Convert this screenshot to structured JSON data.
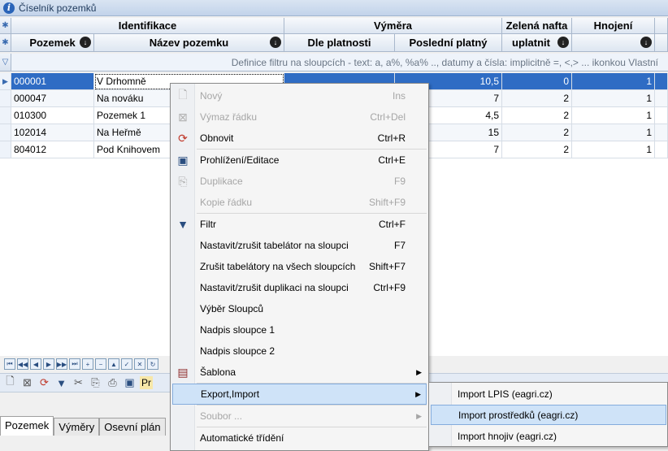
{
  "window": {
    "title": "Číselník pozemků"
  },
  "grid": {
    "group_headers": [
      "Identifikace",
      "Výměra",
      "Zelená nafta",
      "Hnojení"
    ],
    "column_headers": [
      "Pozemek",
      "Název pozemku",
      "Dle platnosti",
      "Poslední platný",
      "uplatnit",
      ""
    ],
    "filter_hint": "Definice filtru na sloupcích - text: a, a%, %a% .., datumy a čísla: implicitně =, <,> ... ikonkou Vlastní",
    "rows": [
      {
        "pozemek": "000001",
        "nazev": "V Drhomně",
        "posledni": "10,5",
        "uplatnit": "0",
        "hnojeni": "1"
      },
      {
        "pozemek": "000047",
        "nazev": "Na nováku",
        "posledni": "7",
        "uplatnit": "2",
        "hnojeni": "1"
      },
      {
        "pozemek": "010300",
        "nazev": "Pozemek 1",
        "posledni": "4,5",
        "uplatnit": "2",
        "hnojeni": "1"
      },
      {
        "pozemek": "102014",
        "nazev": "Na Heřmě",
        "posledni": "15",
        "uplatnit": "2",
        "hnojeni": "1"
      },
      {
        "pozemek": "804012",
        "nazev": "Pod Knihovem",
        "posledni": "7",
        "uplatnit": "2",
        "hnojeni": "1"
      }
    ]
  },
  "toolbar": {
    "truncated_label": "Pr"
  },
  "tabs": [
    "Pozemek",
    "Výměry",
    "Osevní plán"
  ],
  "context_menu": {
    "items": [
      {
        "label": "Nový",
        "shortcut": "Ins",
        "disabled": true,
        "icon": "new-document-icon"
      },
      {
        "label": "Výmaz řádku",
        "shortcut": "Ctrl+Del",
        "disabled": true,
        "icon": "delete-row-icon"
      },
      {
        "label": "Obnovit",
        "shortcut": "Ctrl+R",
        "disabled": false,
        "icon": "refresh-icon"
      },
      {
        "label": "Prohlížení/Editace",
        "shortcut": "Ctrl+E",
        "disabled": false,
        "icon": "edit-view-icon"
      },
      {
        "label": "Duplikace",
        "shortcut": "F9",
        "disabled": true,
        "icon": "duplicate-icon"
      },
      {
        "label": "Kopie řádku",
        "shortcut": "Shift+F9",
        "disabled": true,
        "icon": ""
      },
      {
        "label": "Filtr",
        "shortcut": "Ctrl+F",
        "disabled": false,
        "icon": "filter-icon"
      },
      {
        "label": "Nastavit/zrušit tabelátor na sloupci",
        "shortcut": "F7",
        "disabled": false,
        "icon": ""
      },
      {
        "label": "Zrušit tabelátory na všech sloupcích",
        "shortcut": "Shift+F7",
        "disabled": false,
        "icon": ""
      },
      {
        "label": "Nastavit/zrušit duplikaci na sloupci",
        "shortcut": "Ctrl+F9",
        "disabled": false,
        "icon": ""
      },
      {
        "label": "Výběr Sloupců",
        "shortcut": "",
        "disabled": false,
        "icon": ""
      },
      {
        "label": "Nadpis sloupce 1",
        "shortcut": "",
        "disabled": false,
        "icon": ""
      },
      {
        "label": "Nadpis sloupce 2",
        "shortcut": "",
        "disabled": false,
        "icon": ""
      },
      {
        "label": "Šablona",
        "shortcut": "",
        "disabled": false,
        "icon": "template-icon",
        "submenu": true
      },
      {
        "label": "Export,Import",
        "shortcut": "",
        "disabled": false,
        "icon": "",
        "submenu": true,
        "highlighted": true
      },
      {
        "label": "Soubor ...",
        "shortcut": "",
        "disabled": true,
        "icon": "",
        "submenu": true
      },
      {
        "label": "Automatické třídění",
        "shortcut": "",
        "disabled": false,
        "icon": ""
      }
    ]
  },
  "submenu": {
    "items": [
      {
        "label": "Import LPIS (eagri.cz)"
      },
      {
        "label": "Import prostředků  (eagri.cz)",
        "highlighted": true
      },
      {
        "label": "Import hnojiv  (eagri.cz)"
      }
    ]
  }
}
